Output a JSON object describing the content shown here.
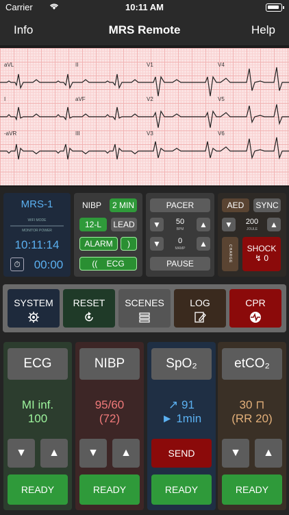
{
  "status_bar": {
    "carrier": "Carrier",
    "time": "10:11 AM"
  },
  "nav": {
    "title": "MRS Remote",
    "left": "Info",
    "right": "Help"
  },
  "ecg_leads": [
    "aVL",
    "II",
    "V1",
    "V4",
    "I",
    "aVF",
    "V2",
    "V5",
    "-aVR",
    "III",
    "V3",
    "V6"
  ],
  "device": {
    "name": "MRS-1",
    "wifi_mode": "WIFI MODE",
    "monitor_power": "MONITOR POWER",
    "clock": "10:11:14",
    "timer": "00:00"
  },
  "monitor": {
    "nibp": "NIBP",
    "interval": "2 MIN",
    "twelve_lead": "12-L",
    "lead": "LEAD",
    "alarm": "ALARM",
    "ecg": "ECG"
  },
  "pacer": {
    "label": "PACER",
    "rate": "50",
    "rate_unit": "BPM",
    "current": "0",
    "current_unit": "MAMP",
    "pause": "PAUSE"
  },
  "defib": {
    "aed": "AED",
    "sync": "SYNC",
    "energy": "200",
    "energy_unit": "JOULE",
    "charge": "CHARGE",
    "shock": "SHOCK",
    "shock_count": "↯ 0"
  },
  "main_buttons": [
    "SYSTEM",
    "RESET",
    "SCENES",
    "LOG",
    "CPR"
  ],
  "vitals": {
    "ecg": {
      "name": "ECG",
      "line1": "MI inf.",
      "line2": "100",
      "ready": "READY"
    },
    "nibp": {
      "name": "NIBP",
      "line1": "95/60",
      "line2": "(72)",
      "ready": "READY"
    },
    "spo2": {
      "name": "SpO₂",
      "line1": "↗ 91",
      "line2": "► 1min",
      "send": "SEND",
      "ready": "READY"
    },
    "etco2": {
      "name": "etCO₂",
      "line1": "30 ⊓",
      "line2": "(RR 20)",
      "ready": "READY"
    }
  },
  "colors": {
    "accent_blue": "#5bb0f0",
    "ready_green": "#2f9a3a",
    "alert_red": "#8b0a0a",
    "ecg_value": "#9ef59e",
    "nibp_value": "#f07a7a",
    "etco2_value": "#e3b07a"
  }
}
